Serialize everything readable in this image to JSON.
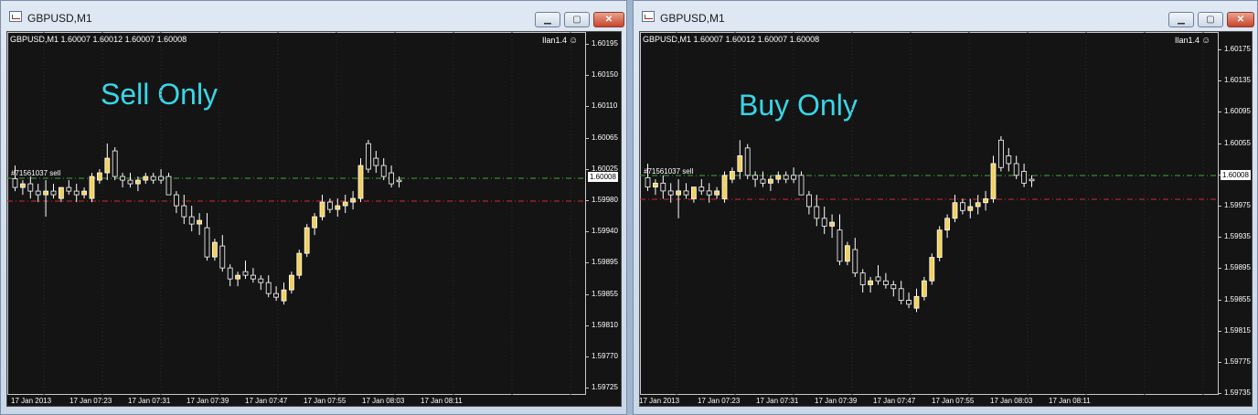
{
  "windows": [
    {
      "title": "GBPUSD,M1",
      "symbol_info": "GBPUSD,M1  1.60007 1.60012 1.60007 1.60008",
      "ea_name": "Ilan1.4",
      "mode_text": "Sell Only",
      "order_label": "#71561037 sell",
      "current_price": "1.60008",
      "price_labels": [
        "1.60195",
        "1.60150",
        "1.60110",
        "1.60065",
        "1.60025",
        "1.59980",
        "1.59940",
        "1.59895",
        "1.59855",
        "1.59810",
        "1.59770",
        "1.59725"
      ],
      "time_labels": [
        "17 Jan 2013",
        "17 Jan 07:23",
        "17 Jan 07:31",
        "17 Jan 07:39",
        "17 Jan 07:47",
        "17 Jan 07:55",
        "17 Jan 08:03",
        "17 Jan 08:11"
      ]
    },
    {
      "title": "GBPUSD,M1",
      "symbol_info": "GBPUSD,M1  1.60007 1.60012 1.60007 1.60008",
      "ea_name": "Ilan1.4",
      "mode_text": "Buy Only",
      "order_label": "#71561037 sell",
      "current_price": "1.60008",
      "price_labels": [
        "1.60175",
        "1.60135",
        "1.60095",
        "1.60055",
        "1.60015",
        "1.59975",
        "1.59935",
        "1.59895",
        "1.59855",
        "1.59815",
        "1.59775",
        "1.59735"
      ],
      "time_labels": [
        "17 Jan 2013",
        "17 Jan 07:23",
        "17 Jan 07:31",
        "17 Jan 07:39",
        "17 Jan 07:47",
        "17 Jan 07:55",
        "17 Jan 08:03",
        "17 Jan 08:11"
      ]
    }
  ],
  "colors": {
    "bull_fill": "#f3d15a",
    "bear_fill": "#141414",
    "candle_outline": "#ffffff",
    "green_line": "#3da83d",
    "red_line": "#d42a2a",
    "mode_text": "#38d6e8"
  },
  "icons": {
    "minimize": "minimize-icon",
    "maximize": "maximize-icon",
    "close": "close-icon",
    "smile": "smile-icon"
  },
  "button_glyphs": {
    "minimize": "▁",
    "maximize": "▢",
    "close": "✕",
    "smile": "☺"
  },
  "candles": [
    [
      1.60012,
      1.6003,
      1.59995,
      1.6
    ],
    [
      1.6,
      1.6001,
      1.5999,
      1.60005
    ],
    [
      1.60005,
      1.60015,
      1.59985,
      1.59995
    ],
    [
      1.59995,
      1.60005,
      1.5998,
      1.5999
    ],
    [
      1.5999,
      1.6001,
      1.5996,
      1.59995
    ],
    [
      1.59995,
      1.60005,
      1.59985,
      1.5999
    ],
    [
      1.59985,
      1.6,
      1.5998,
      1.6
    ],
    [
      1.6,
      1.6001,
      1.5999,
      1.59995
    ],
    [
      1.59995,
      1.60005,
      1.5998,
      1.5999
    ],
    [
      1.5999,
      1.6,
      1.59985,
      1.59995
    ],
    [
      1.59985,
      1.6002,
      1.5998,
      1.60015
    ],
    [
      1.6001,
      1.60025,
      1.60005,
      1.6002
    ],
    [
      1.6002,
      1.6006,
      1.6001,
      1.6004
    ],
    [
      1.6005,
      1.60055,
      1.6001,
      1.60015
    ],
    [
      1.60015,
      1.6002,
      1.6,
      1.6001
    ],
    [
      1.6001,
      1.6002,
      1.6,
      1.60005
    ],
    [
      1.60005,
      1.60015,
      1.59995,
      1.6001
    ],
    [
      1.6001,
      1.6002,
      1.60005,
      1.60015
    ],
    [
      1.60015,
      1.6002,
      1.60005,
      1.6001
    ],
    [
      1.60015,
      1.60025,
      1.60005,
      1.6001
    ],
    [
      1.60015,
      1.6002,
      1.5999,
      1.5999
    ],
    [
      1.5999,
      1.59995,
      1.59965,
      1.59975
    ],
    [
      1.59975,
      1.5999,
      1.5995,
      1.5996
    ],
    [
      1.5996,
      1.59975,
      1.5994,
      1.5995
    ],
    [
      1.5995,
      1.59965,
      1.59935,
      1.59955
    ],
    [
      1.59945,
      1.59965,
      1.599,
      1.59905
    ],
    [
      1.59905,
      1.5993,
      1.599,
      1.59925
    ],
    [
      1.5992,
      1.59935,
      1.59885,
      1.5989
    ],
    [
      1.5989,
      1.59895,
      1.59865,
      1.59875
    ],
    [
      1.59875,
      1.59885,
      1.59865,
      1.5988
    ],
    [
      1.59885,
      1.599,
      1.59875,
      1.5988
    ],
    [
      1.5988,
      1.5989,
      1.5987,
      1.59875
    ],
    [
      1.59875,
      1.5988,
      1.5986,
      1.5987
    ],
    [
      1.5987,
      1.5988,
      1.5985,
      1.59855
    ],
    [
      1.59855,
      1.59865,
      1.59845,
      1.5985
    ],
    [
      1.59845,
      1.5987,
      1.5984,
      1.5986
    ],
    [
      1.5986,
      1.59885,
      1.59855,
      1.5988
    ],
    [
      1.5988,
      1.59915,
      1.59875,
      1.5991
    ],
    [
      1.5991,
      1.5995,
      1.59905,
      1.59945
    ],
    [
      1.59945,
      1.59965,
      1.59935,
      1.5996
    ],
    [
      1.5996,
      1.5999,
      1.59955,
      1.5998
    ],
    [
      1.5998,
      1.59985,
      1.59965,
      1.5997
    ],
    [
      1.5997,
      1.59985,
      1.5996,
      1.59975
    ],
    [
      1.59975,
      1.5999,
      1.59965,
      1.5998
    ],
    [
      1.5998,
      1.59995,
      1.5997,
      1.59985
    ],
    [
      1.59985,
      1.6004,
      1.5998,
      1.6003
    ],
    [
      1.6006,
      1.60065,
      1.6002,
      1.60025
    ],
    [
      1.6004,
      1.6005,
      1.6002,
      1.6003
    ],
    [
      1.6003,
      1.6004,
      1.6001,
      1.60015
    ],
    [
      1.6002,
      1.6003,
      1.6,
      1.60005
    ],
    [
      1.6001,
      1.60015,
      1.6,
      1.60008
    ]
  ]
}
